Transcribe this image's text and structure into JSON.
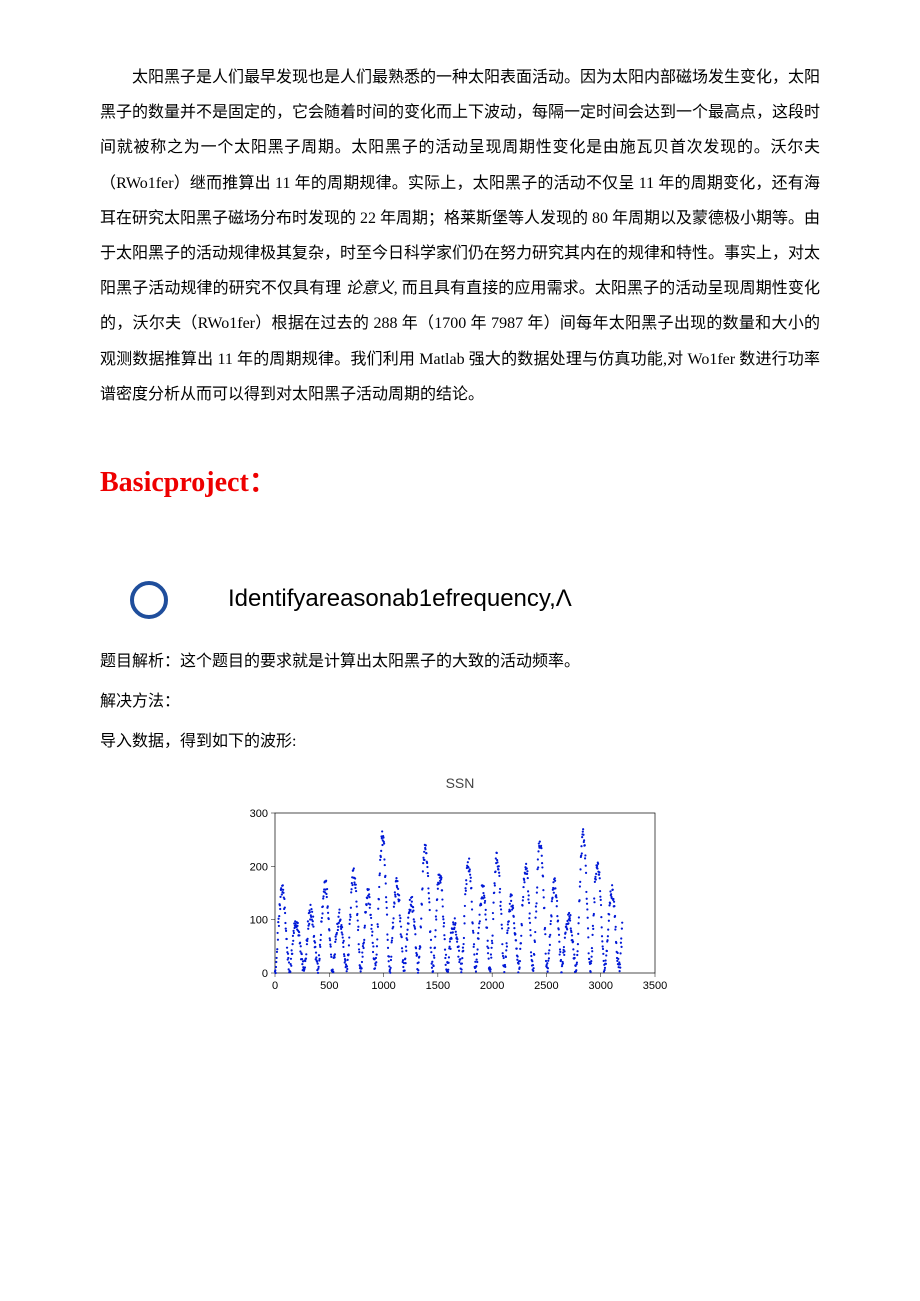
{
  "paragraph": {
    "p1_part1": "太阳黑子是人们最早发现也是人们最熟悉的一种太阳表面活动。因为太阳内部磁场发生变化，太阳黑子的数量并不是固定的，它会随着时间的变化而上下波动，每隔一定时间会达到一个最高点，这段时间就被称之为一个太阳黑子周期。太阳黑子的活动呈现周期性变化是由施瓦贝首次发现的。沃尔夫（RWo1fer）继而推算出 11 年的周期规律。实际上，太阳黑子的活动不仅呈 11 年的周期变化，还有海耳在研究太阳黑子磁场分布时发现的 22 年周期；格莱斯堡等人发现的 80 年周期以及蒙德极小期等。由于太阳黑子的活动规律极其复杂，时至今日科学家们仍在努力研究其内在的规律和特性。事实上，对太阳黑子活动规律的研究不仅具有理",
    "p1_italic": "论意义,",
    "p1_part2": "而且具有直接的应用需求。太阳黑子的活动呈现周期性变化的，沃尔夫（RWo1fer）根据在过去的 288 年（1700 年 7987 年）间每年太阳黑子出现的数量和大小的观测数据推算出 11 年的周期规律。我们利用 Matlab 强大的数据处理与仿真功能,对 Wo1fer 数进行功率谱密度分析从而可以得到对太阳黑子活动周期的结论。"
  },
  "heading": "Basicproject：",
  "bullet": "Identifyareasonab1efrequency,Λ",
  "body": {
    "line1": "题目解析：这个题目的要求就是计算出太阳黑子的大致的活动频率。",
    "line2": "解决方法：",
    "line3": "导入数据，得到如下的波形:"
  },
  "chart_data": {
    "type": "scatter",
    "title": "SSN",
    "xlabel": "",
    "ylabel": "",
    "xlim": [
      0,
      3500
    ],
    "ylim": [
      0,
      300
    ],
    "xticks": [
      0,
      500,
      1000,
      1500,
      2000,
      2500,
      3000,
      3500
    ],
    "yticks": [
      0,
      100,
      200,
      300
    ],
    "note": "Monthly sunspot number time series; approximately 24 cycles across ~3200 samples (~132 samples per cycle), peaks commonly between 100 and 250, troughs near 0–20."
  }
}
